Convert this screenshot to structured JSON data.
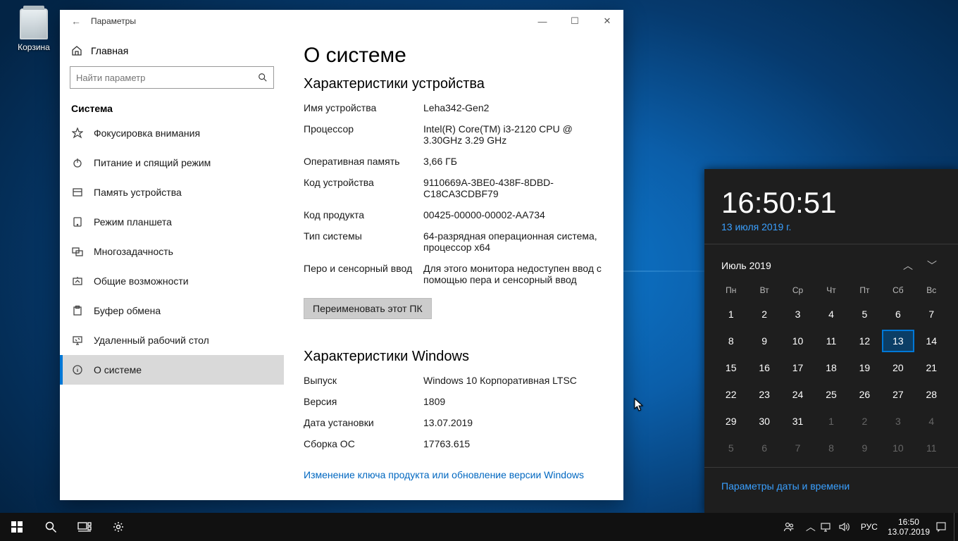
{
  "desktop": {
    "recycle_bin_label": "Корзина"
  },
  "window": {
    "title": "Параметры",
    "controls": {
      "minimize": "—",
      "maximize": "☐",
      "close": "✕"
    },
    "back_glyph": "←"
  },
  "sidebar": {
    "home_label": "Главная",
    "search_placeholder": "Найти параметр",
    "category_title": "Система",
    "items": [
      {
        "icon": "focus",
        "label": "Фокусировка внимания",
        "selected": false
      },
      {
        "icon": "power",
        "label": "Питание и спящий режим",
        "selected": false
      },
      {
        "icon": "storage",
        "label": "Память устройства",
        "selected": false
      },
      {
        "icon": "tablet",
        "label": "Режим планшета",
        "selected": false
      },
      {
        "icon": "multitask",
        "label": "Многозадачность",
        "selected": false
      },
      {
        "icon": "shared",
        "label": "Общие возможности",
        "selected": false
      },
      {
        "icon": "clipboard",
        "label": "Буфер обмена",
        "selected": false
      },
      {
        "icon": "remote",
        "label": "Удаленный рабочий стол",
        "selected": false
      },
      {
        "icon": "about",
        "label": "О системе",
        "selected": true
      }
    ]
  },
  "about": {
    "page_title": "О системе",
    "device_heading": "Характеристики устройства",
    "device_specs": [
      {
        "label": "Имя устройства",
        "value": "Leha342-Gen2"
      },
      {
        "label": "Процессор",
        "value": "Intel(R) Core(TM) i3-2120 CPU @ 3.30GHz   3.29 GHz"
      },
      {
        "label": "Оперативная память",
        "value": "3,66 ГБ"
      },
      {
        "label": "Код устройства",
        "value": "9110669A-3BE0-438F-8DBD-C18CA3CDBF79"
      },
      {
        "label": "Код продукта",
        "value": "00425-00000-00002-AA734"
      },
      {
        "label": "Тип системы",
        "value": "64-разрядная операционная система, процессор x64"
      },
      {
        "label": "Перо и сенсорный ввод",
        "value": "Для этого монитора недоступен ввод с помощью пера и сенсорный ввод"
      }
    ],
    "rename_button": "Переименовать этот ПК",
    "windows_heading": "Характеристики Windows",
    "windows_specs": [
      {
        "label": "Выпуск",
        "value": "Windows 10 Корпоративная LTSC"
      },
      {
        "label": "Версия",
        "value": "1809"
      },
      {
        "label": "Дата установки",
        "value": "13.07.2019"
      },
      {
        "label": "Сборка ОС",
        "value": "17763.615"
      }
    ],
    "change_key_link": "Изменение ключа продукта или обновление версии Windows"
  },
  "clock_flyout": {
    "time": "16:50:51",
    "date_text": "13 июля 2019 г.",
    "month_label": "Июль 2019",
    "dow": [
      "Пн",
      "Вт",
      "Ср",
      "Чт",
      "Пт",
      "Сб",
      "Вс"
    ],
    "weeks": [
      [
        "1",
        "2",
        "3",
        "4",
        "5",
        "6",
        "7"
      ],
      [
        "8",
        "9",
        "10",
        "11",
        "12",
        "13",
        "14"
      ],
      [
        "15",
        "16",
        "17",
        "18",
        "19",
        "20",
        "21"
      ],
      [
        "22",
        "23",
        "24",
        "25",
        "26",
        "27",
        "28"
      ],
      [
        "29",
        "30",
        "31",
        "1",
        "2",
        "3",
        "4"
      ],
      [
        "5",
        "6",
        "7",
        "8",
        "9",
        "10",
        "11"
      ]
    ],
    "today_index": [
      1,
      5
    ],
    "out_of_month_start": [
      4,
      3
    ],
    "footer_link": "Параметры даты и времени"
  },
  "taskbar": {
    "lang": "РУС",
    "clock_time": "16:50",
    "clock_date": "13.07.2019"
  }
}
